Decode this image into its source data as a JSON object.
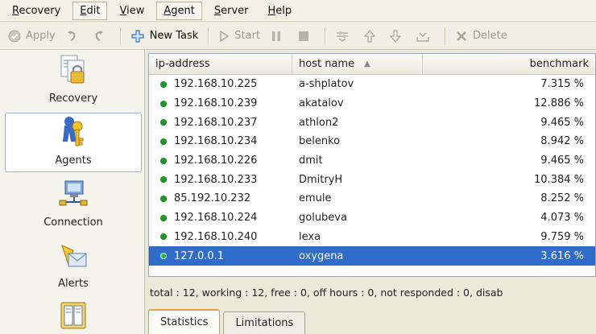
{
  "menu": {
    "items": [
      "Recovery",
      "Edit",
      "View",
      "Agent",
      "Server",
      "Help"
    ]
  },
  "toolbar": {
    "apply": "Apply",
    "new_task": "New Task",
    "start": "Start",
    "delete": "Delete"
  },
  "sidebar": {
    "items": [
      {
        "label": "Recovery",
        "icon": "recovery-icon"
      },
      {
        "label": "Agents",
        "icon": "agents-icon"
      },
      {
        "label": "Connection",
        "icon": "connection-icon"
      },
      {
        "label": "Alerts",
        "icon": "alerts-icon"
      },
      {
        "label": "",
        "icon": "book-icon"
      }
    ]
  },
  "table": {
    "columns": [
      "ip-address",
      "host name",
      "benchmark"
    ],
    "rows": [
      {
        "ip": "192.168.10.225",
        "host": "a-shplatov",
        "bench": "7.315 %"
      },
      {
        "ip": "192.168.10.239",
        "host": "akatalov",
        "bench": "12.886 %"
      },
      {
        "ip": "192.168.10.237",
        "host": "athlon2",
        "bench": "9.465 %"
      },
      {
        "ip": "192.168.10.234",
        "host": "belenko",
        "bench": "8.942 %"
      },
      {
        "ip": "192.168.10.226",
        "host": "dmit",
        "bench": "9.465 %"
      },
      {
        "ip": "192.168.10.233",
        "host": "DmitryH",
        "bench": "10.384 %"
      },
      {
        "ip": "85.192.10.232",
        "host": "emule",
        "bench": "8.252 %"
      },
      {
        "ip": "192.168.10.224",
        "host": "golubeva",
        "bench": "4.073 %"
      },
      {
        "ip": "192.168.10.240",
        "host": "lexa",
        "bench": "9.759 %"
      },
      {
        "ip": "127.0.0.1",
        "host": "oxygena",
        "bench": "3.616 %"
      }
    ]
  },
  "status": "total : 12,  working : 12,  free : 0,  off hours : 0,  not responded : 0,  disab",
  "tabs": [
    "Statistics",
    "Limitations"
  ],
  "colors": {
    "selection": "#2f6bc8",
    "online_dot": "#1e9b27",
    "tab_accent": "#e8a23c"
  }
}
